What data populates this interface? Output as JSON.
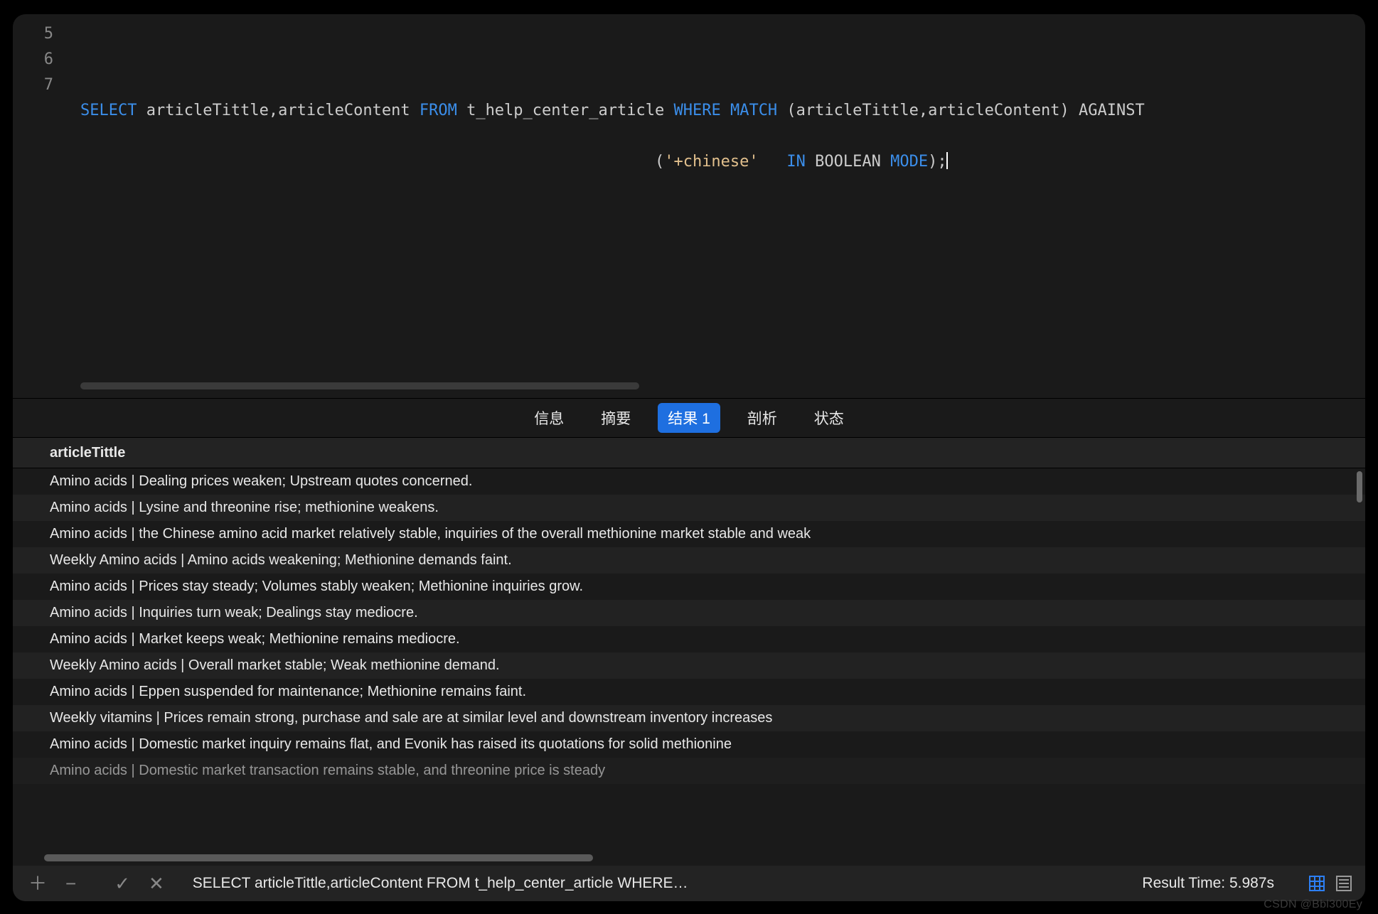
{
  "editor": {
    "line_numbers": [
      "5",
      "6",
      "7"
    ],
    "line6": {
      "select": "SELECT",
      "cols": " articleTittle,articleContent ",
      "from": "FROM",
      "tbl": " t_help_center_article ",
      "where": "WHERE",
      "sp1": " ",
      "match": "MATCH",
      "args": " (articleTittle,articleContent) ",
      "against": "AGAINST"
    },
    "line7": {
      "indent": "                                                             ",
      "open": "(",
      "str": "'+chinese'",
      "sp": "   ",
      "in": "IN",
      "sp2": " ",
      "bool": "BOOLEAN ",
      "mode": "MODE",
      "close": ");"
    }
  },
  "tabs": {
    "info": "信息",
    "summary": "摘要",
    "results": "结果 1",
    "profile": "剖析",
    "status": "状态"
  },
  "table": {
    "column": "articleTittle",
    "rows": [
      "Amino acids | Dealing prices weaken; Upstream quotes concerned.",
      "Amino acids | Lysine and threonine rise; methionine weakens.",
      "Amino acids | the Chinese amino acid market relatively stable, inquiries of the overall methionine market stable and weak",
      "Weekly Amino acids | Amino acids weakening; Methionine demands faint.",
      "Amino acids | Prices stay steady; Volumes stably weaken; Methionine inquiries grow.",
      "Amino acids | Inquiries turn weak; Dealings stay mediocre.",
      "Amino acids | Market keeps weak; Methionine remains mediocre.",
      "Weekly Amino acids | Overall market stable; Weak methionine demand.",
      "Amino acids | Eppen suspended for maintenance; Methionine remains faint.",
      "Weekly vitamins | Prices remain strong, purchase and sale are at similar level and downstream inventory increases",
      "Amino acids | Domestic market inquiry remains flat, and Evonik has raised its quotations for solid methionine",
      "Amino acids | Domestic market transaction remains stable, and threonine price is steady"
    ]
  },
  "statusbar": {
    "query": "SELECT articleTittle,articleContent FROM t_help_center_article WHERE…",
    "result_time": "Result Time: 5.987s"
  },
  "watermark": "CSDN @Bbl300Ey"
}
